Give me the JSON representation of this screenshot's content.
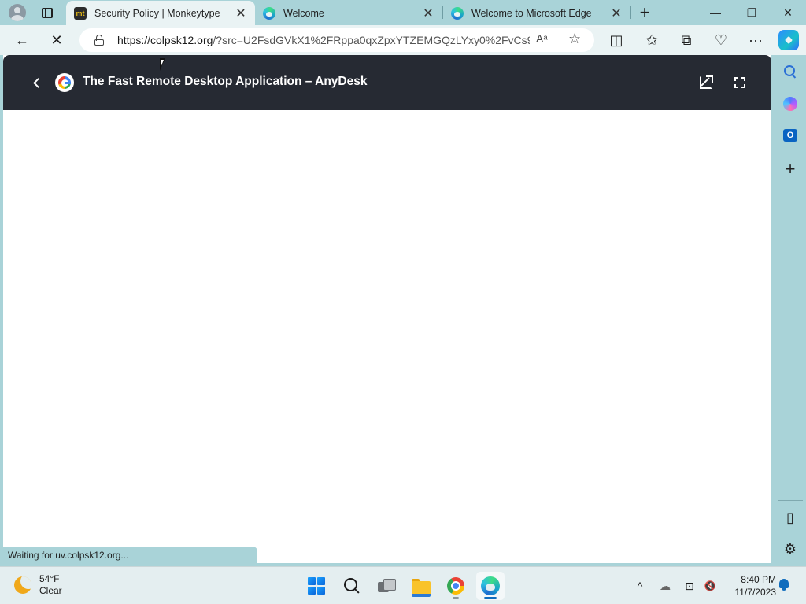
{
  "browser": {
    "tabs": [
      {
        "title": "Security Policy | Monkeytype",
        "favicon": "monkeytype-icon",
        "favicon_text": "mt",
        "active": true
      },
      {
        "title": "Welcome",
        "favicon": "edge-icon",
        "active": false
      },
      {
        "title": "Welcome to Microsoft Edge",
        "favicon": "edge-icon",
        "active": false
      }
    ],
    "new_tab_glyph": "+",
    "window_controls": {
      "minimize": "—",
      "restore": "❐",
      "close": "✕"
    },
    "close_tab_glyph": "✕"
  },
  "toolbar": {
    "back_glyph": "←",
    "stop_glyph": "✕",
    "url_host": "https://colpsk12.org",
    "url_rest": "/?src=U2FsdGVkX1%2FRppa0qxZpxYTZEMGQzLYxy0%2FvCs9x...",
    "read_aloud_glyph": "Aᵃ",
    "favorite_glyph": "☆",
    "split_screen_glyph": "◫",
    "favorites_glyph": "✩",
    "collections_glyph": "⧉",
    "performance_glyph": "♡",
    "more_glyph": "···"
  },
  "viewer": {
    "title": "The Fast Remote Desktop Application – AnyDesk"
  },
  "sidebar": {
    "add_glyph": "+",
    "outlook_letter": "O",
    "layout_glyph": "▯",
    "settings_glyph": "⚙"
  },
  "status_text": "Waiting for uv.colpsk12.org...",
  "taskbar": {
    "weather_temp": "54°F",
    "weather_condition": "Clear",
    "time": "8:40 PM",
    "date": "11/7/2023",
    "tray": {
      "chevron_glyph": "^",
      "cloud_glyph": "☁",
      "network_glyph": "⊡",
      "volume_glyph": "🔇"
    }
  },
  "colors": {
    "frame": "#a9d3d8",
    "toolbar": "#eaf3f4",
    "viewer_header": "#262a33",
    "accent": "#0f6cbd"
  }
}
